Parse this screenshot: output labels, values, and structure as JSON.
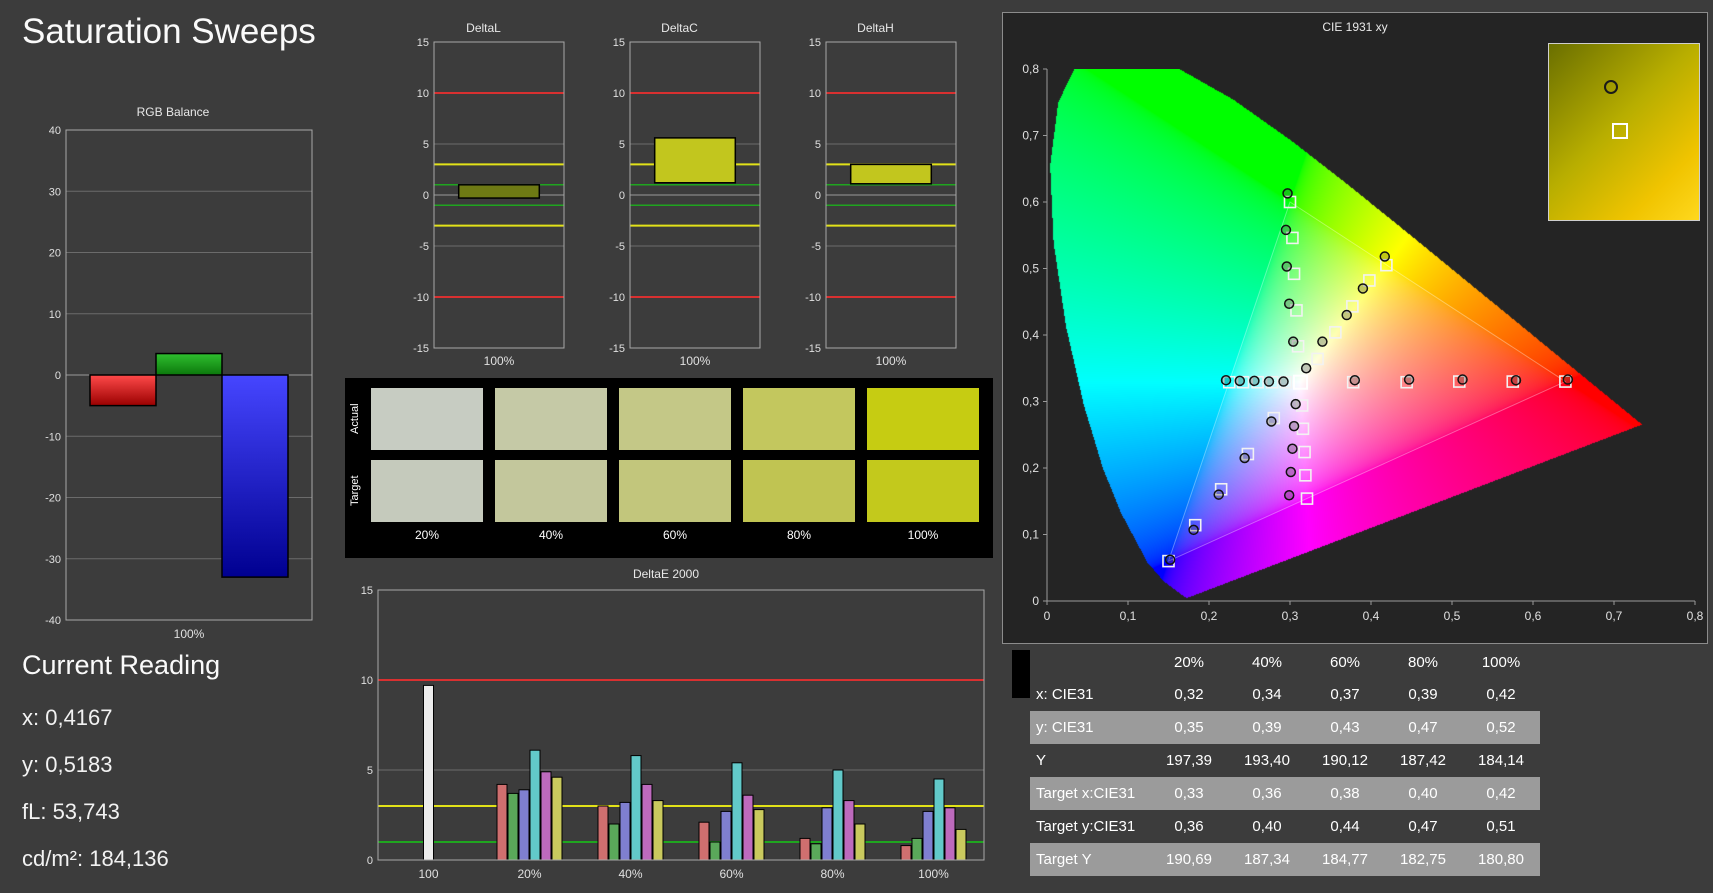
{
  "page": {
    "title": "Saturation Sweeps",
    "background": "#3c3c3c"
  },
  "current_reading": {
    "title": "Current Reading",
    "lines": [
      "x: 0,4167",
      "y: 0,5183",
      "fL: 53,743",
      "cd/m²: 184,136"
    ]
  },
  "swatches": {
    "row_labels": [
      "Actual",
      "Target"
    ],
    "col_labels": [
      "20%",
      "40%",
      "60%",
      "80%",
      "100%"
    ],
    "actual_colors": [
      "#c7ccc2",
      "#c5c9a6",
      "#c4c887",
      "#c3c75e",
      "#c6cc12"
    ],
    "target_colors": [
      "#c5cabc",
      "#c3c79c",
      "#c2c67c",
      "#c0c452",
      "#c3c91c"
    ]
  },
  "table": {
    "columns": [
      "",
      "20%",
      "40%",
      "60%",
      "80%",
      "100%"
    ],
    "rows": [
      {
        "label": "x: CIE31",
        "values": [
          "0,32",
          "0,34",
          "0,37",
          "0,39",
          "0,42"
        ],
        "shaded": false
      },
      {
        "label": "y: CIE31",
        "values": [
          "0,35",
          "0,39",
          "0,43",
          "0,47",
          "0,52"
        ],
        "shaded": true
      },
      {
        "label": "Y",
        "values": [
          "197,39",
          "193,40",
          "190,12",
          "187,42",
          "184,14"
        ],
        "shaded": false
      },
      {
        "label": "Target x:CIE31",
        "values": [
          "0,33",
          "0,36",
          "0,38",
          "0,40",
          "0,42"
        ],
        "shaded": true
      },
      {
        "label": "Target y:CIE31",
        "values": [
          "0,36",
          "0,40",
          "0,44",
          "0,47",
          "0,51"
        ],
        "shaded": false
      },
      {
        "label": "Target Y",
        "values": [
          "190,69",
          "187,34",
          "184,77",
          "182,75",
          "180,80"
        ],
        "shaded": true
      }
    ]
  },
  "chart_data": [
    {
      "name": "rgb_balance",
      "type": "bar",
      "title": "RGB Balance",
      "xlabel": "100%",
      "ylim": [
        -40,
        40
      ],
      "ytick_step": 10,
      "bars": [
        {
          "name": "red",
          "value": -5,
          "grad": [
            "#ff4a4a",
            "#9a0000"
          ]
        },
        {
          "name": "green",
          "value": 3.5,
          "grad": [
            "#2fbf2f",
            "#0c780c"
          ]
        },
        {
          "name": "blue",
          "value": -33,
          "grad": [
            "#4646ff",
            "#000090"
          ]
        }
      ]
    },
    {
      "name": "deltaL",
      "type": "bar",
      "title": "DeltaL",
      "xlabel": "100%",
      "ylim": [
        -15,
        15
      ],
      "ref_lines": {
        "red": 10,
        "yellow": 3,
        "green": 1
      },
      "bar": {
        "from": -0.3,
        "to": 1.0,
        "color": "#6e7a14"
      }
    },
    {
      "name": "deltaC",
      "type": "bar",
      "title": "DeltaC",
      "xlabel": "100%",
      "ylim": [
        -15,
        15
      ],
      "ref_lines": {
        "red": 10,
        "yellow": 3,
        "green": 1
      },
      "bar": {
        "from": 1.2,
        "to": 5.6,
        "color": "#c2c61e"
      }
    },
    {
      "name": "deltaH",
      "type": "bar",
      "title": "DeltaH",
      "xlabel": "100%",
      "ylim": [
        -15,
        15
      ],
      "ref_lines": {
        "red": 10,
        "yellow": 3,
        "green": 1
      },
      "bar": {
        "from": 1.1,
        "to": 3.0,
        "color": "#c2c61e"
      }
    },
    {
      "name": "deltae2000",
      "type": "bar",
      "title": "DeltaE 2000",
      "ylim": [
        0,
        15
      ],
      "yticks": [
        0,
        5,
        10,
        15
      ],
      "ref_lines": [
        {
          "value": 10,
          "color": "#d93030"
        },
        {
          "value": 3,
          "color": "#e2e218"
        },
        {
          "value": 1,
          "color": "#1fa51f"
        }
      ],
      "categories": [
        "100",
        "20%",
        "40%",
        "60%",
        "80%",
        "100%"
      ],
      "series": [
        {
          "name": "white",
          "color": "#ececec",
          "values": [
            9.7,
            null,
            null,
            null,
            null,
            null
          ]
        },
        {
          "name": "red",
          "color": "#cf6f6f",
          "values": [
            null,
            4.2,
            3.0,
            2.1,
            1.2,
            0.8
          ]
        },
        {
          "name": "green",
          "color": "#5aa85a",
          "values": [
            null,
            3.7,
            2.0,
            1.0,
            0.9,
            1.2
          ]
        },
        {
          "name": "blue",
          "color": "#7f7fd0",
          "values": [
            null,
            3.9,
            3.2,
            2.7,
            2.9,
            2.7
          ]
        },
        {
          "name": "cyan",
          "color": "#62c9c9",
          "values": [
            null,
            6.1,
            5.8,
            5.4,
            5.0,
            4.5
          ]
        },
        {
          "name": "magenta",
          "color": "#bd6abd",
          "values": [
            null,
            4.9,
            4.2,
            3.6,
            3.3,
            2.9
          ]
        },
        {
          "name": "yellow",
          "color": "#c9c95e",
          "values": [
            null,
            4.6,
            3.3,
            2.8,
            2.0,
            1.7
          ]
        }
      ]
    },
    {
      "name": "cie",
      "type": "scatter",
      "title": "CIE 1931 xy",
      "xlim": [
        0,
        0.8
      ],
      "ylim": [
        0,
        0.8
      ],
      "xticks": [
        "0",
        "0,1",
        "0,2",
        "0,3",
        "0,4",
        "0,5",
        "0,6",
        "0,7",
        "0,8"
      ],
      "yticks": [
        "0",
        "0,1",
        "0,2",
        "0,3",
        "0,4",
        "0,5",
        "0,6",
        "0,7",
        "0,8"
      ],
      "gamut_triangle": [
        [
          0.64,
          0.33
        ],
        [
          0.3,
          0.6
        ],
        [
          0.15,
          0.06
        ]
      ],
      "white_point": [
        0.313,
        0.329
      ],
      "sweeps": [
        {
          "name": "red",
          "targets": [
            [
              0.378,
              0.329
            ],
            [
              0.444,
              0.329
            ],
            [
              0.509,
              0.33
            ],
            [
              0.575,
              0.33
            ],
            [
              0.64,
              0.33
            ]
          ],
          "measured": [
            [
              0.38,
              0.332
            ],
            [
              0.447,
              0.333
            ],
            [
              0.513,
              0.333
            ],
            [
              0.579,
              0.332
            ],
            [
              0.643,
              0.333
            ]
          ]
        },
        {
          "name": "green",
          "targets": [
            [
              0.31,
              0.383
            ],
            [
              0.308,
              0.437
            ],
            [
              0.305,
              0.492
            ],
            [
              0.303,
              0.546
            ],
            [
              0.3,
              0.6
            ]
          ],
          "measured": [
            [
              0.304,
              0.39
            ],
            [
              0.299,
              0.447
            ],
            [
              0.296,
              0.503
            ],
            [
              0.295,
              0.558
            ],
            [
              0.297,
              0.613
            ]
          ]
        },
        {
          "name": "blue",
          "targets": [
            [
              0.28,
              0.275
            ],
            [
              0.248,
              0.221
            ],
            [
              0.215,
              0.168
            ],
            [
              0.183,
              0.114
            ],
            [
              0.15,
              0.06
            ]
          ],
          "measured": [
            [
              0.277,
              0.27
            ],
            [
              0.244,
              0.215
            ],
            [
              0.212,
              0.16
            ],
            [
              0.181,
              0.107
            ],
            [
              0.152,
              0.062
            ]
          ]
        },
        {
          "name": "cyan",
          "targets": [
            [
              0.295,
              0.329
            ],
            [
              0.278,
              0.329
            ],
            [
              0.26,
              0.329
            ],
            [
              0.242,
              0.329
            ],
            [
              0.225,
              0.329
            ]
          ],
          "measured": [
            [
              0.292,
              0.33
            ],
            [
              0.274,
              0.33
            ],
            [
              0.256,
              0.331
            ],
            [
              0.238,
              0.331
            ],
            [
              0.221,
              0.332
            ]
          ]
        },
        {
          "name": "magenta",
          "targets": [
            [
              0.315,
              0.294
            ],
            [
              0.316,
              0.259
            ],
            [
              0.318,
              0.224
            ],
            [
              0.319,
              0.189
            ],
            [
              0.321,
              0.154
            ]
          ],
          "measured": [
            [
              0.307,
              0.296
            ],
            [
              0.305,
              0.263
            ],
            [
              0.303,
              0.229
            ],
            [
              0.301,
              0.194
            ],
            [
              0.299,
              0.159
            ]
          ]
        },
        {
          "name": "yellow",
          "targets": [
            [
              0.334,
              0.364
            ],
            [
              0.356,
              0.404
            ],
            [
              0.377,
              0.443
            ],
            [
              0.398,
              0.482
            ],
            [
              0.419,
              0.505
            ]
          ],
          "measured": [
            [
              0.32,
              0.35
            ],
            [
              0.34,
              0.39
            ],
            [
              0.37,
              0.43
            ],
            [
              0.39,
              0.47
            ],
            [
              0.417,
              0.518
            ]
          ]
        }
      ],
      "inset": {
        "circle": [
          62,
          43
        ],
        "square": [
          64,
          80
        ]
      }
    }
  ]
}
